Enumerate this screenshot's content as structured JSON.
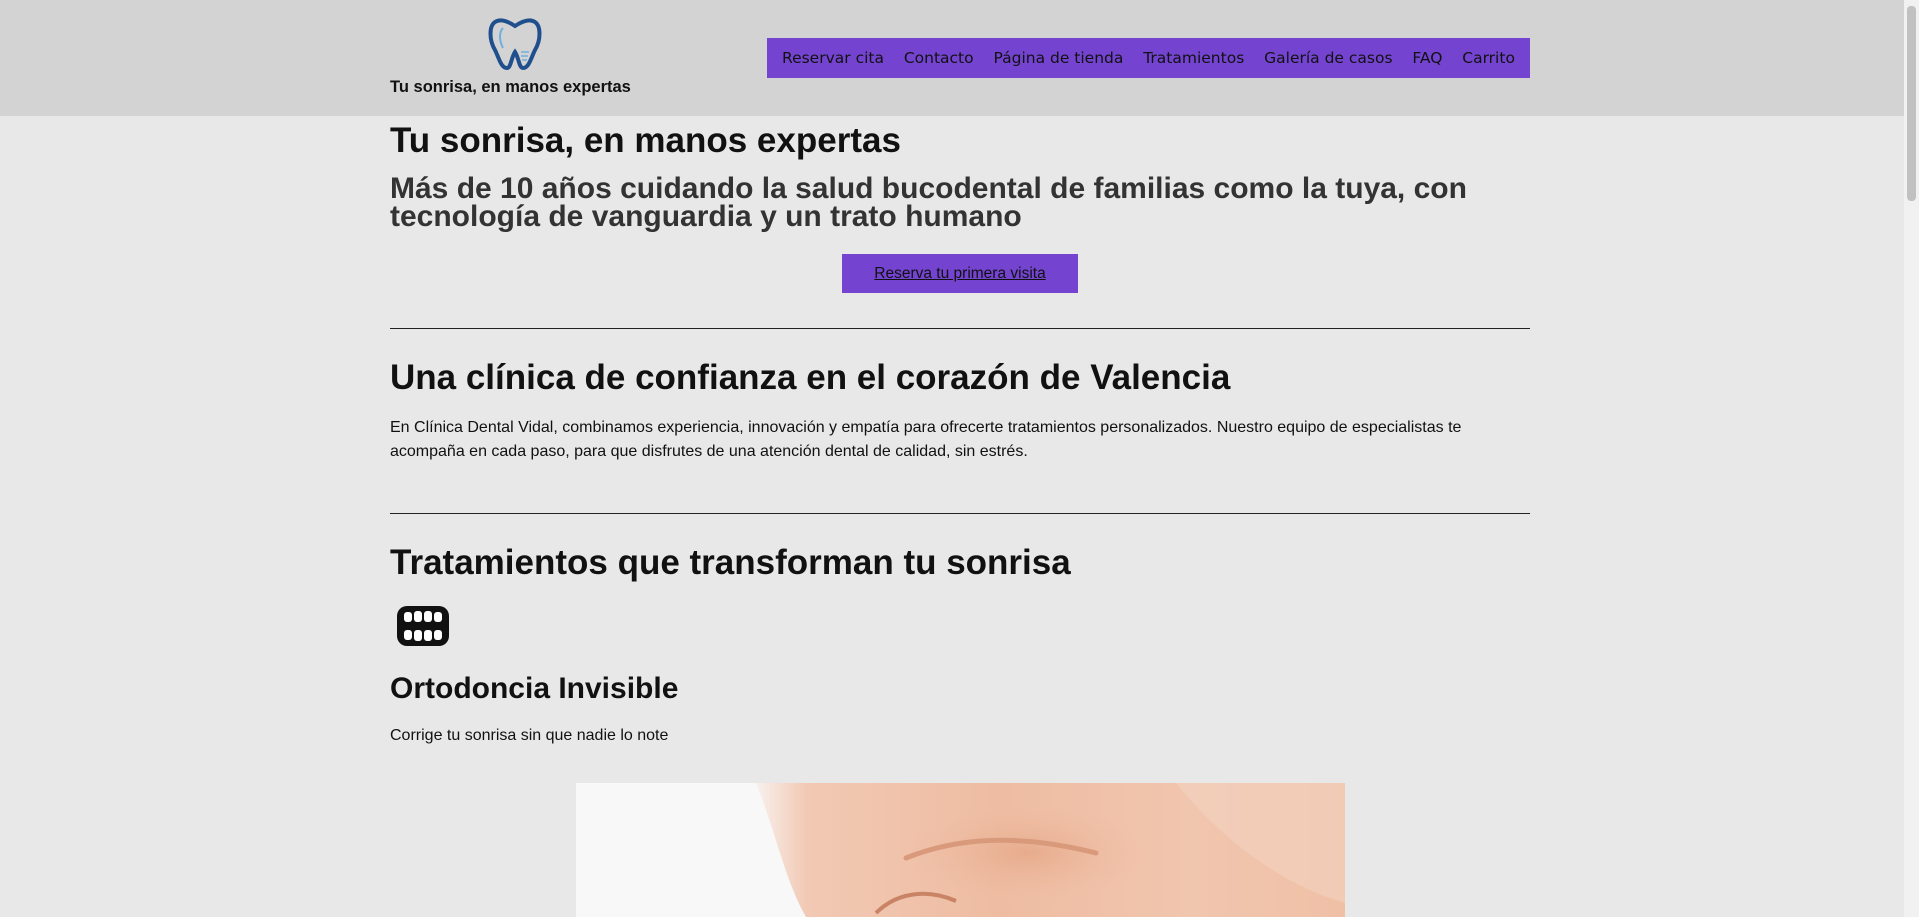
{
  "header": {
    "tagline": "Tu sonrisa, en manos expertas",
    "logo_icon": "tooth-icon",
    "nav": [
      {
        "label": "Reservar cita"
      },
      {
        "label": "Contacto"
      },
      {
        "label": "Página de tienda"
      },
      {
        "label": "Tratamientos"
      },
      {
        "label": "Galería de casos"
      },
      {
        "label": "FAQ"
      },
      {
        "label": "Carrito"
      }
    ],
    "nav_color": "#7444d1"
  },
  "hero": {
    "title": "Tu sonrisa, en manos expertas",
    "subtitle": "Más de 10 años cuidando la salud bucodental de familias como la tuya, con tecnología de vanguardia y un trato humano",
    "cta_label": "Reserva tu primera visita"
  },
  "about": {
    "title": "Una clínica de confianza en el corazón de Valencia",
    "text": "En Clínica Dental Vidal, combinamos experiencia, innovación y empatía para ofrecerte tratamientos personalizados. Nuestro equipo de especialistas te acompaña en cada paso, para que disfrutes de una atención dental de calidad, sin estrés."
  },
  "treatments": {
    "title": "Tratamientos que transforman tu sonrisa",
    "items": [
      {
        "icon": "teeth-icon",
        "title": "Ortodoncia Invisible",
        "description": "Corrige tu sonrisa sin que nadie lo note",
        "image": "smile-photo"
      }
    ]
  }
}
